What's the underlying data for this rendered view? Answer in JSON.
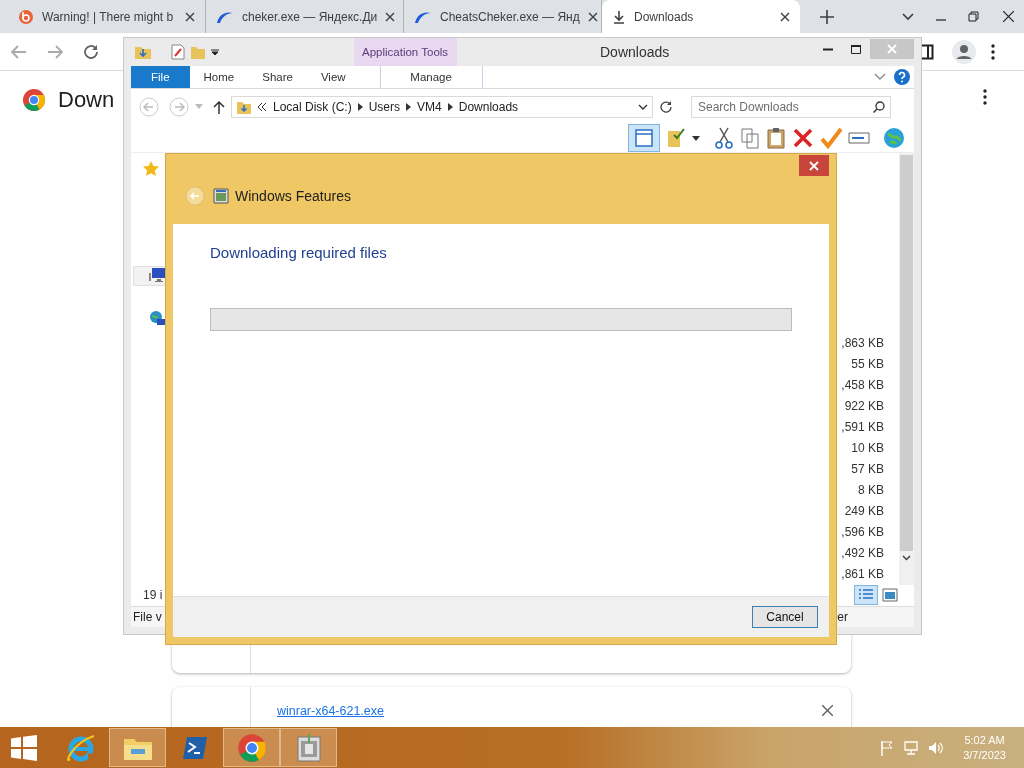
{
  "browser": {
    "tabs": [
      {
        "label": "Warning! | There might b",
        "kind": "site",
        "selected": false
      },
      {
        "label": "cheker.exe — Яндекс.Ди",
        "kind": "disk",
        "selected": false
      },
      {
        "label": "CheatsCheker.exe — Янд",
        "kind": "disk",
        "selected": false
      },
      {
        "label": "Downloads",
        "kind": "download",
        "selected": true
      }
    ],
    "page_title": "Down",
    "downloads": [
      {
        "file": "winrar-x64-621.exe"
      }
    ]
  },
  "explorer": {
    "title": "Downloads",
    "context_tab": "Application Tools",
    "ribbon_tabs": [
      {
        "label": "File",
        "selected": true
      },
      {
        "label": "Home",
        "selected": false
      },
      {
        "label": "Share",
        "selected": false
      },
      {
        "label": "View",
        "selected": false
      },
      {
        "label": "Manage",
        "selected": false
      }
    ],
    "breadcrumb": [
      "Local Disk (C:)",
      "Users",
      "VM4",
      "Downloads"
    ],
    "search": {
      "placeholder": "Search Downloads"
    },
    "sizes": [
      ",863 KB",
      "55 KB",
      ",458 KB",
      "922 KB",
      ",591 KB",
      "10 KB",
      "57 KB",
      "8 KB",
      "249 KB",
      ",596 KB",
      ",492 KB",
      ",861 KB"
    ],
    "status": "19 i",
    "details_left": "File v",
    "details_right": "er"
  },
  "dialog": {
    "title": "Windows Features",
    "heading": "Downloading required files",
    "progress": {
      "level": 0
    },
    "button": "Cancel"
  },
  "taskbar": {
    "apps": [
      {
        "kind": "ie",
        "open": false
      },
      {
        "kind": "explorer",
        "open": true
      },
      {
        "kind": "powershell",
        "open": false
      },
      {
        "kind": "chrome",
        "open": true
      },
      {
        "kind": "features",
        "open": true
      }
    ],
    "time": "5:02 AM",
    "date": "3/7/2023"
  }
}
